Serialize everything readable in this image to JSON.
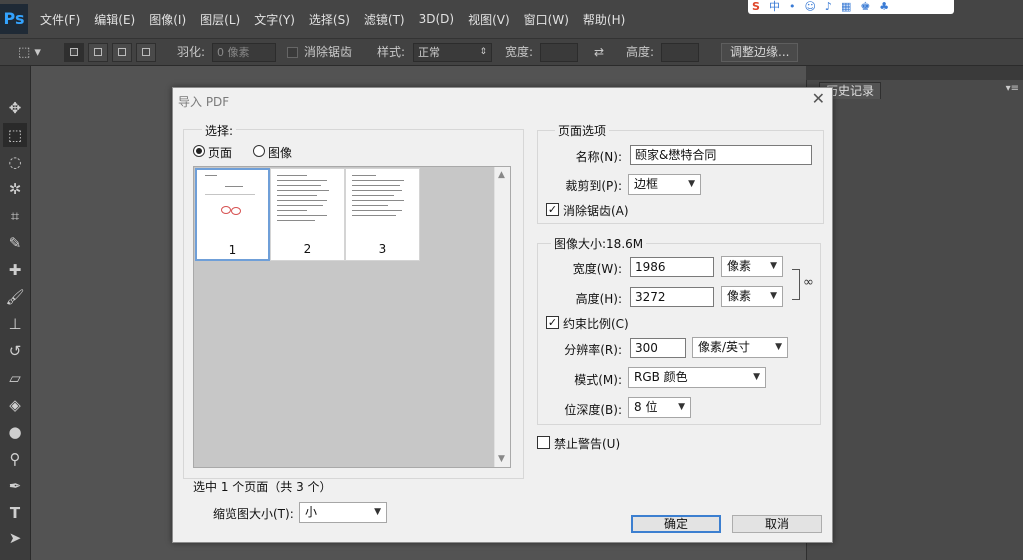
{
  "app": {
    "logo": "Ps",
    "menu": [
      "文件(F)",
      "编辑(E)",
      "图像(I)",
      "图层(L)",
      "文字(Y)",
      "选择(S)",
      "滤镜(T)",
      "3D(D)",
      "视图(V)",
      "窗口(W)",
      "帮助(H)"
    ],
    "tray_icons": [
      "S",
      "中",
      "•",
      "☺",
      "♪",
      "▦",
      "♚",
      "♣"
    ]
  },
  "options_bar": {
    "feather_label": "羽化:",
    "feather_value": "0 像素",
    "antialias_label": "消除锯齿",
    "style_label": "样式:",
    "style_value": "正常",
    "width_label": "宽度:",
    "height_label": "高度:",
    "refine_edge_button": "调整边缘..."
  },
  "panel": {
    "history_tab": "历史记录"
  },
  "dialog": {
    "title": "导入 PDF",
    "select_group": {
      "legend": "选择:",
      "radio_page": "页面",
      "radio_image": "图像",
      "selected_mode": "页面",
      "thumbnails": [
        "1",
        "2",
        "3"
      ],
      "selected_thumbnail": "1",
      "selection_status": "选中 1 个页面（共 3 个）",
      "thumb_size_label": "缩览图大小(T):",
      "thumb_size_value": "小"
    },
    "page_options": {
      "legend": "页面选项",
      "name_label": "名称(N):",
      "name_value": "颐家&懋特合同",
      "crop_label": "裁剪到(P):",
      "crop_value": "边框",
      "antialias_label": "消除锯齿(A)",
      "antialias_checked": true
    },
    "image_size": {
      "legend": "图像大小:18.6M",
      "width_label": "宽度(W):",
      "width_value": "1986",
      "width_unit": "像素",
      "height_label": "高度(H):",
      "height_value": "3272",
      "height_unit": "像素",
      "constrain_label": "约束比例(C)",
      "constrain_checked": true,
      "resolution_label": "分辨率(R):",
      "resolution_value": "300",
      "resolution_unit": "像素/英寸",
      "mode_label": "模式(M):",
      "mode_value": "RGB 颜色",
      "depth_label": "位深度(B):",
      "depth_value": "8 位"
    },
    "suppress_warnings_label": "禁止警告(U)",
    "suppress_warnings_checked": false,
    "ok_button": "确定",
    "cancel_button": "取消"
  }
}
